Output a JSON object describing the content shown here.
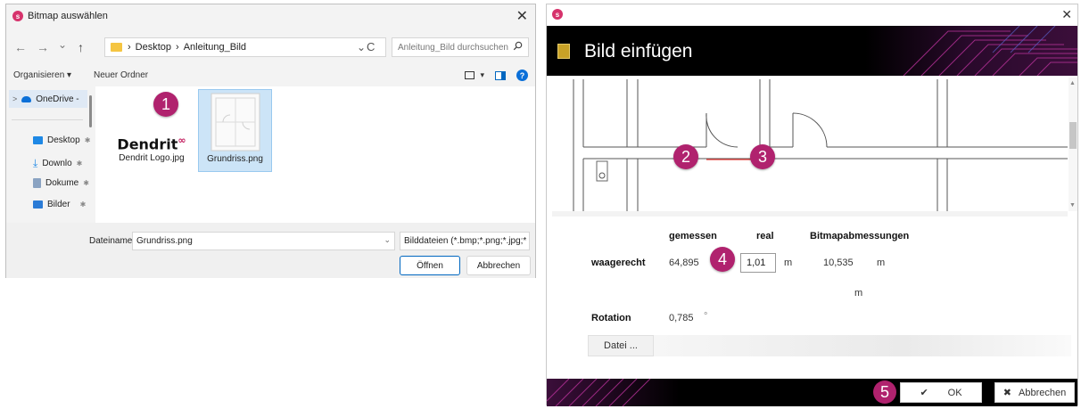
{
  "file_dialog": {
    "title": "Bitmap auswählen",
    "close": "✕",
    "nav": {
      "back": "←",
      "forward": "→",
      "history": "⌄",
      "up": "↑"
    },
    "breadcrumb": [
      "Desktop",
      "Anleitung_Bild"
    ],
    "breadcrumb_sep": "›",
    "address_dropdown": "⌄",
    "refresh": "C",
    "search_placeholder": "Anleitung_Bild durchsuchen",
    "toolbar": {
      "organize": "Organisieren ▾",
      "new_folder": "Neuer Ordner",
      "view_dropdown": "▾",
      "help": "?"
    },
    "sidebar": [
      {
        "label": "OneDrive -",
        "icon": "cloud-icon",
        "expander": ">"
      },
      {
        "label": "Desktop",
        "pin": "✱"
      },
      {
        "label": "Downlo",
        "pin": "✱"
      },
      {
        "label": "Dokume",
        "pin": "✱"
      },
      {
        "label": "Bilder",
        "pin": "✱"
      }
    ],
    "files": [
      {
        "name": "Dendrit Logo.jpg",
        "logo_text": "Dendrit"
      },
      {
        "name": "Grundriss.png"
      }
    ],
    "filename_label": "Dateiname:",
    "filename_value": "Grundriss.png",
    "filetype_value": "Bilddateien (*.bmp;*.png;*.jpg;*",
    "open_label": "Öffnen",
    "cancel_label": "Abbrechen"
  },
  "insert_dialog": {
    "close": "✕",
    "title": "Bild einfügen",
    "columns": {
      "measured": "gemessen",
      "real": "real",
      "bitmap": "Bitmapabmessungen"
    },
    "horizontal": {
      "label": "waagerecht",
      "measured": "64,895",
      "real": "1,01",
      "real_unit": "m",
      "bitmap": "10,535",
      "bitmap_unit": "m"
    },
    "second_unit": "m",
    "rotation": {
      "label": "Rotation",
      "value": "0,785",
      "unit": "°"
    },
    "file_button": "Datei ...",
    "ok_label": "OK",
    "cancel_label": "Abbrechen",
    "ok_icon": "✔",
    "cancel_icon": "✖"
  },
  "steps": [
    "1",
    "2",
    "3",
    "4",
    "5"
  ],
  "colors": {
    "badge": "#b0226e",
    "accent": "#0067c0",
    "brand": "#d6336c"
  }
}
